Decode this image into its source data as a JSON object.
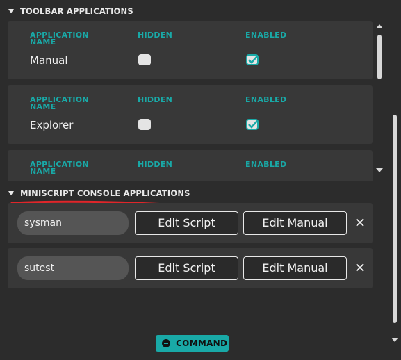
{
  "toolbar_section": {
    "title": "TOOLBAR APPLICATIONS",
    "columns": {
      "name": "APPLICATION NAME",
      "hidden": "HIDDEN",
      "enabled": "ENABLED"
    },
    "apps": [
      {
        "name": "Manual",
        "hidden": false,
        "enabled": true
      },
      {
        "name": "Explorer",
        "hidden": false,
        "enabled": true
      },
      {
        "name": "",
        "hidden": false,
        "enabled": true
      }
    ]
  },
  "console_section": {
    "title": "MINISCRIPT CONSOLE APPLICATIONS",
    "edit_script_label": "Edit Script",
    "edit_manual_label": "Edit Manual",
    "apps": [
      {
        "name": "sysman"
      },
      {
        "name": "sutest"
      }
    ]
  },
  "command_button": {
    "label": "COMMAND"
  },
  "colors": {
    "accent": "#19a9a7",
    "background": "#2c2c2c",
    "card": "#383838",
    "annotation_underline": "#e0262a"
  },
  "icons": {
    "collapse": "triangle-down-icon",
    "checkbox_checked": "checkmark-icon",
    "remove": "close-icon",
    "command": "minus-circle-icon"
  }
}
